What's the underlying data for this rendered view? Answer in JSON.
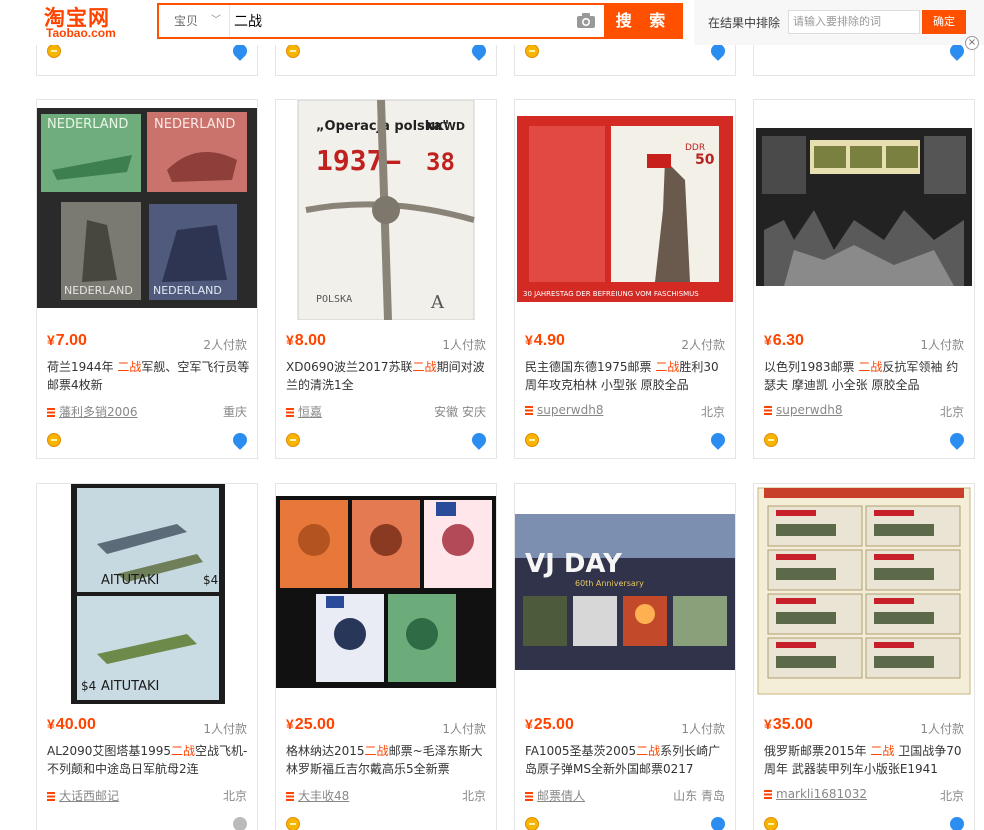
{
  "logo": {
    "cn": "淘宝网",
    "en": "Taobao.com"
  },
  "search": {
    "category": "宝贝",
    "query": "二战",
    "button": "搜 索"
  },
  "exclude": {
    "label": "在结果中排除",
    "placeholder": "请输入要排除的词",
    "button": "确定"
  },
  "colors": {
    "accent": "#ff5000",
    "price": "#ff4400"
  },
  "items": [
    {
      "price": "7.00",
      "paid": "2人付款",
      "title_pre": "荷兰1944年 ",
      "title_hl": "二战",
      "title_post": "军舰、空军飞行员等邮票4枚新",
      "shop": "藩利多销2006",
      "location": "重庆"
    },
    {
      "price": "8.00",
      "paid": "1人付款",
      "title_pre": "XD0690波兰2017苏联",
      "title_hl": "二战",
      "title_post": "期间对波兰的清洗1全",
      "shop": "恒嘉",
      "location": "安徽 安庆"
    },
    {
      "price": "4.90",
      "paid": "2人付款",
      "title_pre": "民主德国东德1975邮票 ",
      "title_hl": "二战",
      "title_post": "胜利30周年攻克柏林 小型张 原胶全品",
      "shop": "superwdh8",
      "location": "北京"
    },
    {
      "price": "6.30",
      "paid": "1人付款",
      "title_pre": "以色列1983邮票 ",
      "title_hl": "二战",
      "title_post": "反抗军领袖 约瑟夫 摩迪凯 小全张 原胶全品",
      "shop": "superwdh8",
      "location": "北京"
    },
    {
      "price": "40.00",
      "paid": "1人付款",
      "title_pre": "AL2090艾图塔基1995",
      "title_hl": "二战",
      "title_post": "空战飞机-不列颠和中途岛日军航母2连",
      "shop": "大话西邮记",
      "location": "北京"
    },
    {
      "price": "25.00",
      "paid": "1人付款",
      "title_pre": "格林纳达2015",
      "title_hl": "二战",
      "title_post": "邮票~毛泽东斯大林罗斯福丘吉尔戴高乐5全新票",
      "shop": "大丰收48",
      "location": "北京"
    },
    {
      "price": "25.00",
      "paid": "1人付款",
      "title_pre": "FA1005圣基茨2005",
      "title_hl": "二战",
      "title_post": "系列长崎广岛原子弹MS全新外国邮票0217",
      "shop": "邮票倩人",
      "location": "山东 青岛"
    },
    {
      "price": "35.00",
      "paid": "1人付款",
      "title_pre": "俄罗斯邮票2015年 ",
      "title_hl": "二战",
      "title_post": " 卫国战争70周年 武器装甲列车小版张E1941",
      "shop": "markli1681032",
      "location": "北京"
    }
  ],
  "stamp_text": {
    "nederland": "NEDERLAND",
    "operacja": "„Operacja polska\"",
    "nkwd": "NKWD",
    "years": "1937–",
    "year38": "38",
    "polska": "POLSKA",
    "ddr": "DDR",
    "ddr_value": "50",
    "ddr_footer": "30 JAHRESTAG DER BEFREIUNG VOM FASCHISMUS",
    "aitutaki": "AITUTAKI",
    "vjday": "VJ DAY",
    "vj_sub": "60th Anniversary"
  }
}
